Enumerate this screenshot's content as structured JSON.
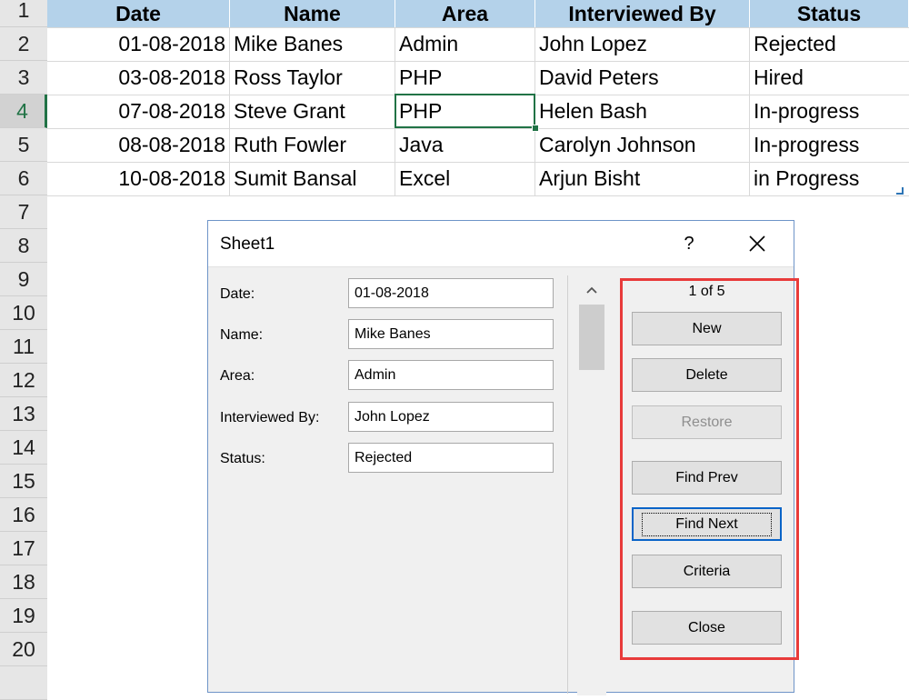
{
  "sheet": {
    "row_numbers": [
      "1",
      "2",
      "3",
      "4",
      "5",
      "6",
      "7",
      "8",
      "9",
      "10",
      "11",
      "12",
      "13",
      "14",
      "15",
      "16",
      "17",
      "18",
      "19",
      "20"
    ],
    "active_row": "4",
    "columns": [
      "Date",
      "Name",
      "Area",
      "Interviewed By",
      "Status"
    ],
    "rows": [
      [
        "01-08-2018",
        "Mike Banes",
        "Admin",
        "John Lopez",
        "Rejected"
      ],
      [
        "03-08-2018",
        "Ross Taylor",
        "PHP",
        "David Peters",
        "Hired"
      ],
      [
        "07-08-2018",
        "Steve Grant",
        "PHP",
        "Helen Bash",
        "In-progress"
      ],
      [
        "08-08-2018",
        "Ruth Fowler",
        "Java",
        "Carolyn Johnson",
        "In-progress"
      ],
      [
        "10-08-2018",
        "Sumit Bansal",
        "Excel",
        "Arjun Bisht",
        "in Progress"
      ]
    ]
  },
  "dialog": {
    "title": "Sheet1",
    "help": "?",
    "fields": [
      {
        "label": "Date:",
        "value": "01-08-2018"
      },
      {
        "label": "Name:",
        "value": "Mike Banes"
      },
      {
        "label": "Area:",
        "value": "Admin"
      },
      {
        "label": "Interviewed By:",
        "value": "John Lopez"
      },
      {
        "label": "Status:",
        "value": "Rejected"
      }
    ],
    "record_counter": "1 of 5",
    "buttons": {
      "new": "New",
      "delete": "Delete",
      "restore": "Restore",
      "find_prev": "Find Prev",
      "find_next": "Find Next",
      "criteria": "Criteria",
      "close": "Close"
    }
  },
  "colors": {
    "header_fill": "#b4d2ea",
    "selection": "#217346",
    "highlight_box": "#e83b3b",
    "focus_blue": "#0a64c8"
  }
}
